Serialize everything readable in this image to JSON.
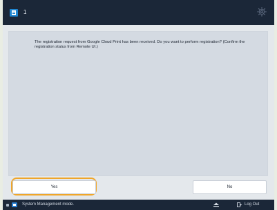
{
  "header": {
    "count": "1"
  },
  "dialog": {
    "message": "The registration request from Google Cloud Print has been received. Do you want to perform registration? (Confirm the registration status from Remote UI.)",
    "yes_label": "Yes",
    "no_label": "No"
  },
  "statusbar": {
    "mode_text": "System Management mode.",
    "logout_label": "Log Out"
  },
  "colors": {
    "top_bar": "#1b2738",
    "panel": "#d4dae2",
    "focus_ring": "#f0a62a",
    "accent_blue": "#1f86d1"
  },
  "icons": {
    "app": "copy-document-icon",
    "settings": "gear-icon",
    "status_led": "status-indicator-icon",
    "status_monitor": "status-monitor-icon",
    "tray": "eject-icon",
    "logout": "logout-icon"
  }
}
